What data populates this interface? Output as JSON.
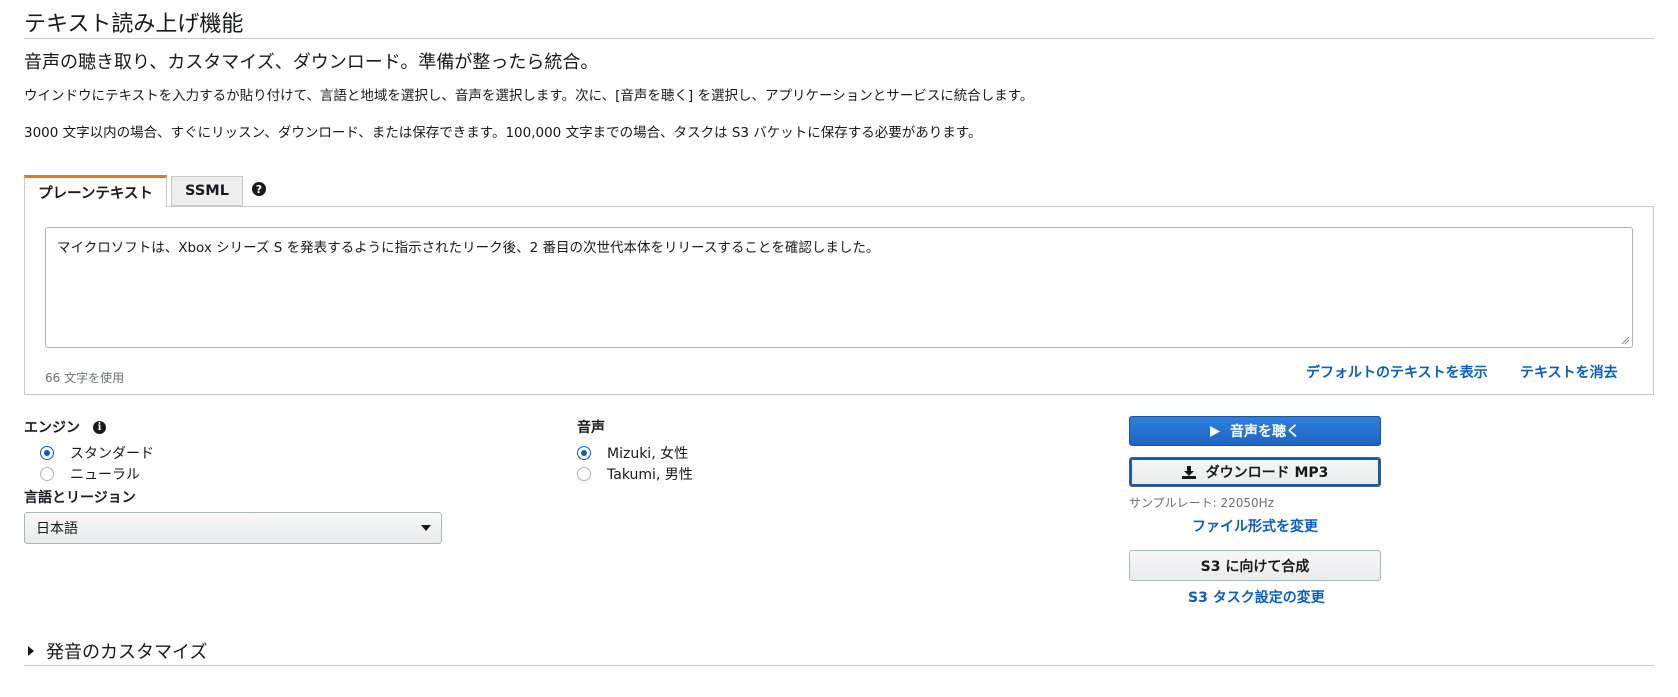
{
  "page": {
    "title": "テキスト読み上げ機能",
    "subtitle": "音声の聴き取り、カスタマイズ、ダウンロード。準備が整ったら統合。",
    "description1": "ウインドウにテキストを入力するか貼り付けて、言語と地域を選択し、音声を選択します。次に、[音声を聴く] を選択し、アプリケーションとサービスに統合します。",
    "description2": "3000 文字以内の場合、すぐにリッスン、ダウンロード、または保存できます。100,000 文字までの場合、タスクは S3 バケットに保存する必要があります。"
  },
  "tabs": {
    "plain": "プレーンテキスト",
    "ssml": "SSML",
    "help_icon": "question-circle-icon",
    "active_accent": "#e07a1f"
  },
  "editor": {
    "text": "マイクロソフトは、Xbox シリーズ S を発表するように指示されたリーク後、2 番目の次世代本体をリリースすることを確認しました。",
    "char_count": "66 文字を使用",
    "show_default_link": "デフォルトのテキストを表示",
    "clear_link": "テキストを消去"
  },
  "engine": {
    "label": "エンジン",
    "info_icon": "info-circle-icon",
    "options": [
      {
        "label": "スタンダード",
        "selected": true
      },
      {
        "label": "ニューラル",
        "selected": false
      }
    ]
  },
  "language": {
    "label": "言語とリージョン",
    "selected": "日本語"
  },
  "voice": {
    "label": "音声",
    "options": [
      {
        "label": "Mizuki, 女性",
        "selected": true
      },
      {
        "label": "Takumi, 男性",
        "selected": false
      }
    ]
  },
  "actions": {
    "listen": "音声を聴く",
    "listen_icon": "play-icon",
    "download": "ダウンロード MP3",
    "download_icon": "download-icon",
    "sample_rate": "サンプルレート: 22050Hz",
    "change_format": "ファイル形式を変更",
    "synthesize_s3": "S3 に向けて合成",
    "change_s3_settings": "S3 タスク設定の変更",
    "primary_color": "#1f64c3",
    "link_color": "#0a5ec2"
  },
  "customize": {
    "label": "発音のカスタマイズ"
  }
}
